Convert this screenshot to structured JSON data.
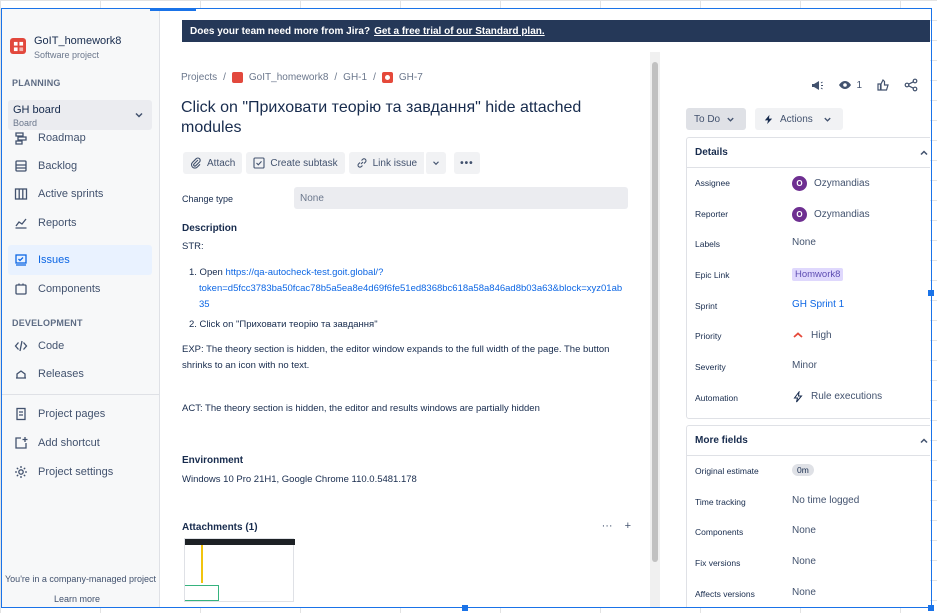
{
  "banner": {
    "text": "Does your team need more from Jira?",
    "link": "Get a free trial of our Standard plan."
  },
  "sidebar": {
    "project_name": "GoIT_homework8",
    "project_type": "Software project",
    "planning_header": "PLANNING",
    "board_name": "GH board",
    "board_sub": "Board",
    "items": [
      {
        "label": "Roadmap",
        "icon": "roadmap-icon"
      },
      {
        "label": "Backlog",
        "icon": "backlog-icon"
      },
      {
        "label": "Active sprints",
        "icon": "board-icon"
      },
      {
        "label": "Reports",
        "icon": "reports-icon"
      },
      {
        "label": "Issues",
        "icon": "issues-icon",
        "active": true
      },
      {
        "label": "Components",
        "icon": "components-icon"
      }
    ],
    "development_header": "DEVELOPMENT",
    "dev_items": [
      {
        "label": "Code",
        "icon": "code-icon"
      },
      {
        "label": "Releases",
        "icon": "releases-icon"
      }
    ],
    "bottom_items": [
      {
        "label": "Project pages",
        "icon": "pages-icon"
      },
      {
        "label": "Add shortcut",
        "icon": "add-shortcut-icon"
      },
      {
        "label": "Project settings",
        "icon": "gear-icon"
      }
    ],
    "footer_text": "You're in a company-managed project",
    "footer_link": "Learn more"
  },
  "breadcrumb": {
    "projects": "Projects",
    "project": "GoIT_homework8",
    "parent": "GH-1",
    "issue": "GH-7"
  },
  "issue": {
    "title": "Click on \"Приховати теорію та завдання\" hide attached modules",
    "toolbar": {
      "attach": "Attach",
      "create_subtask": "Create subtask",
      "link_issue": "Link issue"
    },
    "change_type_label": "Change type",
    "change_type_value": "None",
    "description_header": "Description",
    "str": "STR:",
    "step1_prefix": "1. Open ",
    "step1_link_a": "https://qa-autocheck-test.goit.global/?",
    "step1_link_b": "token=d5fcc3783ba50fcac78b5a5ea8e4d69f6fe51ed8368bc618a58a846ad8b03a63&block=xyz01ab",
    "step1_link_c": "35",
    "step2": "2. Click on \"Приховати теорію та завдання\"",
    "exp": "EXP: The theory section is hidden, the editor window expands to the full width of the page. The button shrinks to an icon with no text.",
    "act": "ACT: The theory section is hidden, the editor and results windows are partially hidden",
    "environment_header": "Environment",
    "environment_value": "Windows 10 Pro 21H1, Google Chrome 110.0.5481.178",
    "attachments_header": "Attachments (1)"
  },
  "right": {
    "watch_count": "1",
    "status": "To Do",
    "actions": "Actions",
    "details_header": "Details",
    "details": [
      {
        "label": "Assignee",
        "value": "Ozymandias",
        "kind": "avatar"
      },
      {
        "label": "Reporter",
        "value": "Ozymandias",
        "kind": "avatar"
      },
      {
        "label": "Labels",
        "value": "None",
        "kind": "text"
      },
      {
        "label": "Epic Link",
        "value": "Homwork8",
        "kind": "epic"
      },
      {
        "label": "Sprint",
        "value": "GH Sprint 1",
        "kind": "sprint"
      },
      {
        "label": "Priority",
        "value": "High",
        "kind": "priority"
      },
      {
        "label": "Severity",
        "value": "Minor",
        "kind": "text"
      },
      {
        "label": "Automation",
        "value": "Rule executions",
        "kind": "automation"
      }
    ],
    "more_header": "More fields",
    "more": [
      {
        "label": "Original estimate",
        "value": "0m",
        "kind": "pill"
      },
      {
        "label": "Time tracking",
        "value": "No time logged",
        "kind": "text"
      },
      {
        "label": "Components",
        "value": "None",
        "kind": "text"
      },
      {
        "label": "Fix versions",
        "value": "None",
        "kind": "text"
      },
      {
        "label": "Affects versions",
        "value": "None",
        "kind": "text"
      }
    ]
  },
  "colors": {
    "banner_bg": "#253858",
    "active_nav": "#e9f2ff",
    "link": "#0c66e4",
    "avatar": "#6e2f91",
    "epic_bg": "#dfd8fd",
    "priority_high": "#e5493a"
  }
}
